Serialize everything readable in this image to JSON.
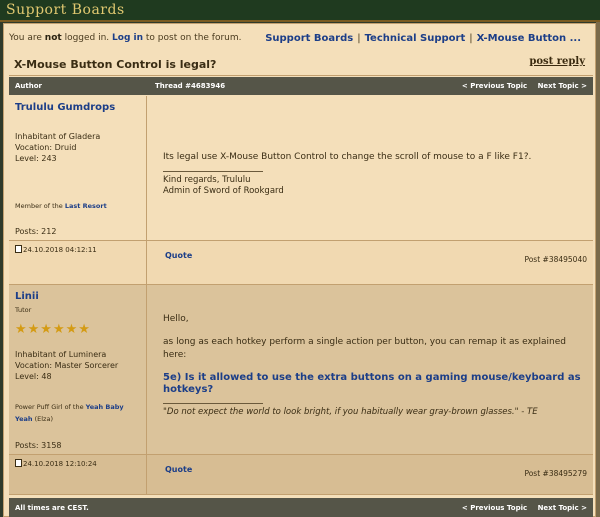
{
  "site": {
    "title": "Support Boards"
  },
  "breadcrumb": {
    "items": [
      "Support Boards",
      "Technical Support",
      "X-Mouse Button ..."
    ]
  },
  "login": {
    "prefix": "You are ",
    "not": "not",
    "middle": " logged in. ",
    "link": "Log in",
    "suffix": " to post on the forum."
  },
  "topic": {
    "title": "X-Mouse Button Control is legal?",
    "post_reply": "post reply"
  },
  "table_header": {
    "author": "Author",
    "thread": "Thread #4683946",
    "prev": "< Previous Topic",
    "next": "Next Topic >"
  },
  "posts": [
    {
      "author": "Trululu Gumdrops",
      "home": "Inhabitant of Gladera",
      "vocation": "Vocation: Druid",
      "level": "Level: 243",
      "guild_prefix": "Member of the ",
      "guild": "Last Resort",
      "posts": "Posts: 212",
      "date": "24.10.2018 04:12:11",
      "quote": "Quote",
      "post_num": "Post #38495040",
      "message": "Its legal use X-Mouse Button Control to change the scroll of mouse to a F like F1?.",
      "sig1": "Kind regards, Trululu",
      "sig2": "Admin of Sword of Rookgard"
    },
    {
      "author": "Linii",
      "rank": "Tutor",
      "stars": "★★★★★★",
      "home": "Inhabitant of Luminera",
      "vocation": "Vocation: Master Sorcerer",
      "level": "Level: 48",
      "guild_prefix": "Power Puff Girl of the ",
      "guild": "Yeah Baby Yeah",
      "guild_suffix": " (Elza)",
      "posts": "Posts: 3158",
      "date": "24.10.2018 12:10:24",
      "quote": "Quote",
      "post_num": "Post #38495279",
      "hello": "Hello,",
      "message": "as long as each hotkey perform a single action per button, you can remap it as explained here:",
      "faq_line1": "5e) Is it allowed to use the extra buttons on a gaming mouse/keyboard as",
      "faq_line2": "hotkeys?",
      "sig_quote": "\"Do not expect the world to look bright, if you habitually wear gray-brown glasses.\" - TE"
    }
  ],
  "footer": {
    "times": "All times are CEST.",
    "prev": "< Previous Topic",
    "next": "Next Topic >"
  },
  "colors": {
    "accent_link": "#1c3e88",
    "header_bg": "#555548",
    "frame_bg": "#f4dfba",
    "star": "#d49b14"
  }
}
